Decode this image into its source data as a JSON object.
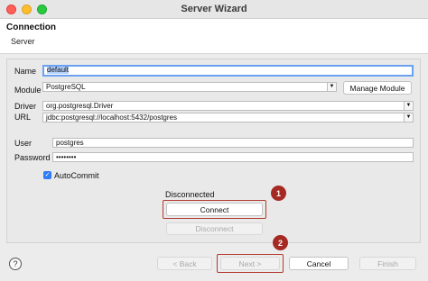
{
  "window": {
    "title": "Server Wizard"
  },
  "banner": {
    "title": "Connection",
    "subtitle": "Server"
  },
  "form": {
    "name_label": "Name",
    "name_value": "default",
    "module_label": "Module",
    "module_value": "PostgreSQL",
    "manage_module_label": "Manage Module",
    "driver_label": "Driver",
    "driver_value": "org.postgresql.Driver",
    "url_label": "URL",
    "url_value": "jdbc:postgresql://localhost:5432/postgres",
    "user_label": "User",
    "user_value": "postgres",
    "password_label": "Password",
    "password_value": "••••••••",
    "autocommit_label": "AutoCommit",
    "status_text": "Disconnected",
    "connect_label": "Connect",
    "disconnect_label": "Disconnect"
  },
  "annotations": {
    "step1": "1",
    "step2": "2"
  },
  "footer": {
    "help_glyph": "?",
    "back_label": "< Back",
    "next_label": "Next >",
    "cancel_label": "Cancel",
    "finish_label": "Finish"
  },
  "icons": [
    "close-icon",
    "minimize-icon",
    "zoom-icon",
    "chevron-down-icon",
    "checkmark-icon",
    "help-icon"
  ],
  "colors": {
    "focus": "#6aa1f0",
    "annotation": "#a62a24",
    "checkbox": "#2f7cf6"
  }
}
